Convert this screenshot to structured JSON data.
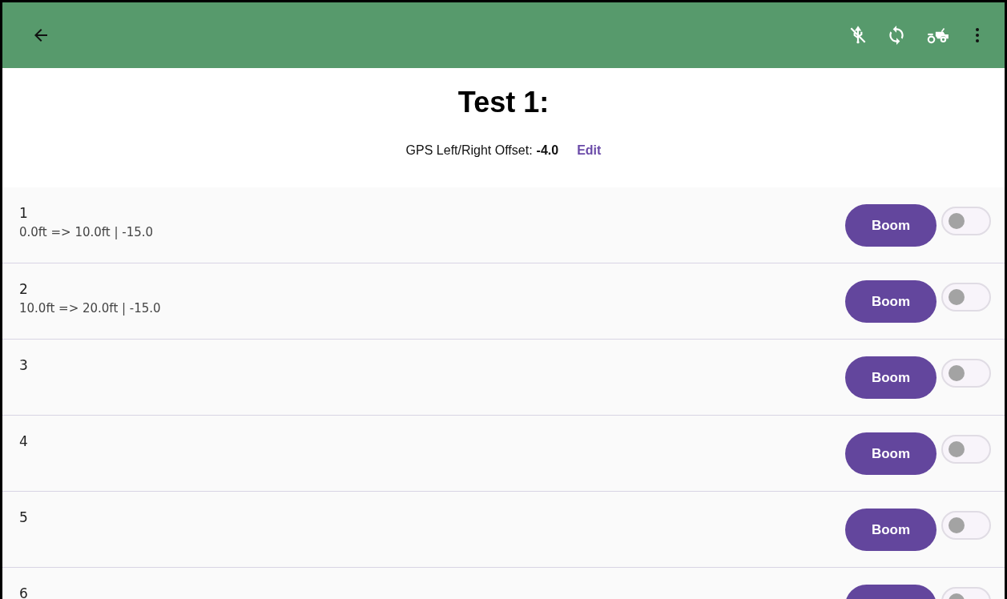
{
  "title": "Test 1:",
  "offset": {
    "label": "GPS Left/Right Offset:",
    "value": "-4.0",
    "action": "Edit"
  },
  "sections": [
    {
      "number": "1",
      "detail": "0.0ft => 10.0ft | -15.0",
      "button": "Boom",
      "on": false
    },
    {
      "number": "2",
      "detail": "10.0ft => 20.0ft | -15.0",
      "button": "Boom",
      "on": false
    },
    {
      "number": "3",
      "button": "Boom",
      "on": false
    },
    {
      "number": "4",
      "button": "Boom",
      "on": false
    },
    {
      "number": "5",
      "button": "Boom",
      "on": false
    },
    {
      "number": "6",
      "on": false
    }
  ]
}
